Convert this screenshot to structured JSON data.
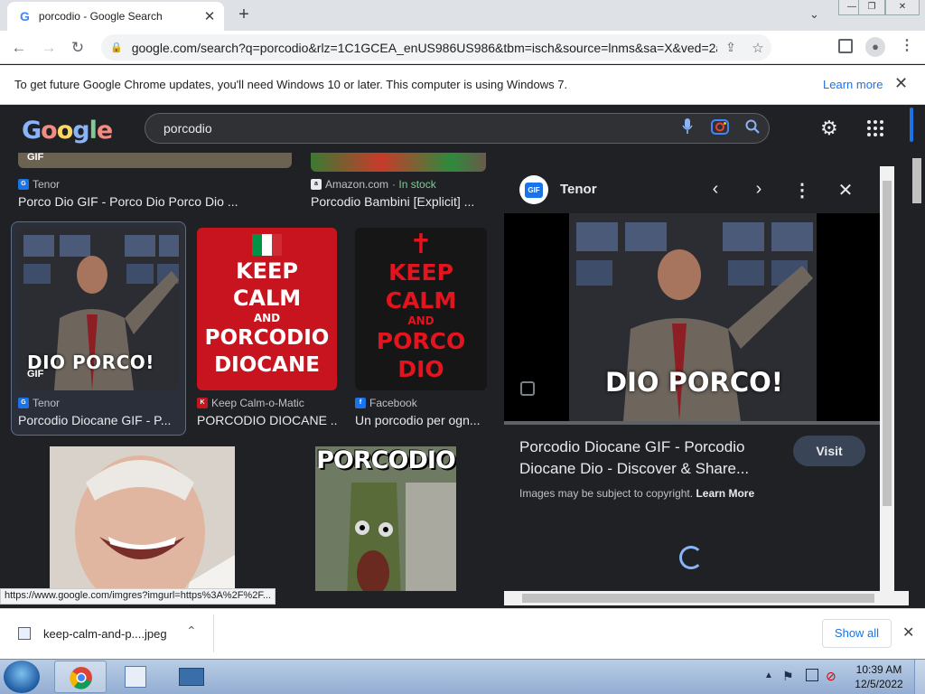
{
  "browser": {
    "tab_title": "porcodio - Google Search",
    "tab_favicon": "G",
    "url": "google.com/search?q=porcodio&rlz=1C1GCEA_enUS986US986&tbm=isch&source=lnms&sa=X&ved=2ahUKE...",
    "status_url": "https://www.google.com/imgres?imgurl=https%3A%2F%2F..."
  },
  "infobar": {
    "message": "To get future Google Chrome updates, you'll need Windows 10 or later. This computer is using Windows 7.",
    "learn_more": "Learn more"
  },
  "search": {
    "logo": "Google",
    "query": "porcodio"
  },
  "results": {
    "top_row": [
      {
        "source": "Tenor",
        "caption": "Porco Dio GIF - Porco Dio Porco Dio ..."
      },
      {
        "source": "Amazon.com",
        "stock": "· In stock",
        "caption": "Porcodio Bambini [Explicit] ..."
      }
    ],
    "row2": [
      {
        "source": "Tenor",
        "caption": "Porcodio Diocane GIF - P...",
        "overlay": "DIO PORCO!",
        "badge": "GIF"
      },
      {
        "source": "Keep Calm-o-Matic",
        "caption": "PORCODIO DIOCANE ...",
        "lines": [
          "KEEP",
          "CALM",
          "AND",
          "PORCODIO",
          "DIOCANE"
        ]
      },
      {
        "source": "Facebook",
        "caption": "Un porcodio per ogn...",
        "lines": [
          "KEEP",
          "CALM",
          "AND",
          "PORCO",
          "DIO"
        ]
      }
    ],
    "row3": [
      {
        "label": ""
      },
      {
        "label": "PORCODIO"
      }
    ],
    "top_overlay": "GIF"
  },
  "panel": {
    "badge": "GIF",
    "source": "Tenor",
    "overlay": "DIO PORCO!",
    "title": "Porcodio Diocane GIF - Porcodio Diocane Dio - Discover & Share...",
    "visit": "Visit",
    "copyright": "Images may be subject to copyright.",
    "learn_more": "Learn More"
  },
  "download": {
    "file": "keep-calm-and-p....jpeg",
    "show_all": "Show all"
  },
  "taskbar": {
    "time": "10:39 AM",
    "date": "12/5/2022"
  },
  "colors": {
    "dark_bg": "#202124",
    "accent_blue": "#8ab4f8",
    "keep_calm_red": "#c8141e"
  }
}
